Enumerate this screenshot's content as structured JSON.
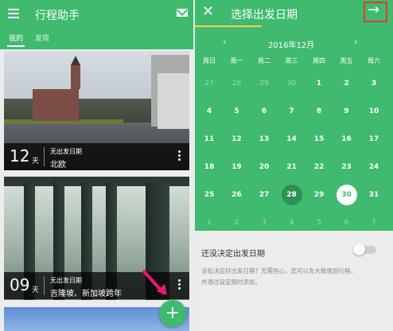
{
  "left": {
    "title": "行程助手",
    "tabs": [
      "我的",
      "发现"
    ],
    "cards": [
      {
        "days": "12",
        "unit": "天",
        "line1": "无出发日期",
        "line2": "北欧"
      },
      {
        "days": "09",
        "unit": "天",
        "line1": "无出发日期",
        "line2": "吉隆坡、新加坡跨年"
      }
    ],
    "fab": "+"
  },
  "right": {
    "title": "选择出发日期",
    "month": "2016年12月",
    "weekdays": [
      "周日",
      "周一",
      "周二",
      "周三",
      "周四",
      "周五",
      "周六"
    ],
    "weeks": [
      [
        "27",
        "28",
        "29",
        "30",
        "1",
        "2",
        "3"
      ],
      [
        "4",
        "5",
        "6",
        "7",
        "8",
        "9",
        "10"
      ],
      [
        "11",
        "12",
        "13",
        "14",
        "15",
        "16",
        "17"
      ],
      [
        "18",
        "19",
        "20",
        "21",
        "22",
        "23",
        "24"
      ],
      [
        "25",
        "26",
        "27",
        "28",
        "29",
        "30",
        "31"
      ],
      [
        "1",
        "2",
        "3",
        "4",
        "5",
        "6",
        "7"
      ]
    ],
    "muted_first_row_count": 4,
    "muted_last_row": true,
    "highlight_today": "28",
    "selected": "30",
    "undecided_label": "还没决定出发日期",
    "undecided_desc_line1": "没有决定好出发日期？无需担心，您可以先大致规划行程，",
    "undecided_desc_line2": "并通过设定随时添加。"
  },
  "colors": {
    "accent": "#3fba6e",
    "annotation": "#e8196f",
    "highlight_box": "#e53935"
  }
}
